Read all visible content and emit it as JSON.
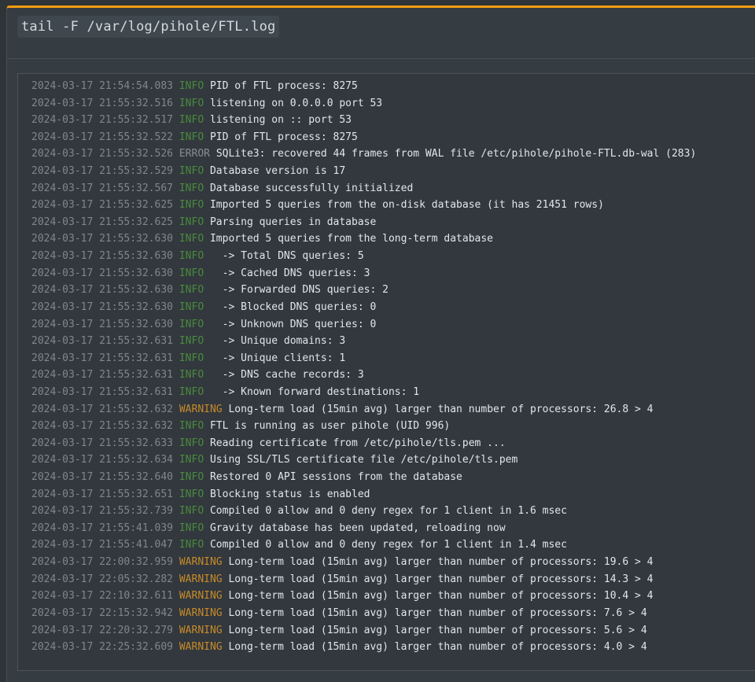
{
  "box": {
    "title": "tail -F /var/log/pihole/FTL.log"
  },
  "log": [
    {
      "time": "2024-03-17 21:54:54.083",
      "level": "INFO",
      "pad": " ",
      "message": "PID of FTL process: 8275"
    },
    {
      "time": "2024-03-17 21:55:32.516",
      "level": "INFO",
      "pad": " ",
      "message": "listening on 0.0.0.0 port 53"
    },
    {
      "time": "2024-03-17 21:55:32.517",
      "level": "INFO",
      "pad": " ",
      "message": "listening on :: port 53"
    },
    {
      "time": "2024-03-17 21:55:32.522",
      "level": "INFO",
      "pad": " ",
      "message": "PID of FTL process: 8275"
    },
    {
      "time": "2024-03-17 21:55:32.526",
      "level": "ERROR",
      "pad": " ",
      "message": "SQLite3: recovered 44 frames from WAL file /etc/pihole/pihole-FTL.db-wal (283)"
    },
    {
      "time": "2024-03-17 21:55:32.529",
      "level": "INFO",
      "pad": " ",
      "message": "Database version is 17"
    },
    {
      "time": "2024-03-17 21:55:32.567",
      "level": "INFO",
      "pad": " ",
      "message": "Database successfully initialized"
    },
    {
      "time": "2024-03-17 21:55:32.625",
      "level": "INFO",
      "pad": " ",
      "message": "Imported 5 queries from the on-disk database (it has 21451 rows)"
    },
    {
      "time": "2024-03-17 21:55:32.625",
      "level": "INFO",
      "pad": " ",
      "message": "Parsing queries in database"
    },
    {
      "time": "2024-03-17 21:55:32.630",
      "level": "INFO",
      "pad": " ",
      "message": "Imported 5 queries from the long-term database"
    },
    {
      "time": "2024-03-17 21:55:32.630",
      "level": "INFO",
      "pad": "  ",
      "message": " -> Total DNS queries: 5"
    },
    {
      "time": "2024-03-17 21:55:32.630",
      "level": "INFO",
      "pad": "  ",
      "message": " -> Cached DNS queries: 3"
    },
    {
      "time": "2024-03-17 21:55:32.630",
      "level": "INFO",
      "pad": "  ",
      "message": " -> Forwarded DNS queries: 2"
    },
    {
      "time": "2024-03-17 21:55:32.630",
      "level": "INFO",
      "pad": "  ",
      "message": " -> Blocked DNS queries: 0"
    },
    {
      "time": "2024-03-17 21:55:32.630",
      "level": "INFO",
      "pad": "  ",
      "message": " -> Unknown DNS queries: 0"
    },
    {
      "time": "2024-03-17 21:55:32.631",
      "level": "INFO",
      "pad": "  ",
      "message": " -> Unique domains: 3"
    },
    {
      "time": "2024-03-17 21:55:32.631",
      "level": "INFO",
      "pad": "  ",
      "message": " -> Unique clients: 1"
    },
    {
      "time": "2024-03-17 21:55:32.631",
      "level": "INFO",
      "pad": "  ",
      "message": " -> DNS cache records: 3"
    },
    {
      "time": "2024-03-17 21:55:32.631",
      "level": "INFO",
      "pad": "  ",
      "message": " -> Known forward destinations: 1"
    },
    {
      "time": "2024-03-17 21:55:32.632",
      "level": "WARNING",
      "pad": " ",
      "message": "Long-term load (15min avg) larger than number of processors: 26.8 > 4"
    },
    {
      "time": "2024-03-17 21:55:32.632",
      "level": "INFO",
      "pad": " ",
      "message": "FTL is running as user pihole (UID 996)"
    },
    {
      "time": "2024-03-17 21:55:32.633",
      "level": "INFO",
      "pad": " ",
      "message": "Reading certificate from /etc/pihole/tls.pem ..."
    },
    {
      "time": "2024-03-17 21:55:32.634",
      "level": "INFO",
      "pad": " ",
      "message": "Using SSL/TLS certificate file /etc/pihole/tls.pem"
    },
    {
      "time": "2024-03-17 21:55:32.640",
      "level": "INFO",
      "pad": " ",
      "message": "Restored 0 API sessions from the database"
    },
    {
      "time": "2024-03-17 21:55:32.651",
      "level": "INFO",
      "pad": " ",
      "message": "Blocking status is enabled"
    },
    {
      "time": "2024-03-17 21:55:32.739",
      "level": "INFO",
      "pad": " ",
      "message": "Compiled 0 allow and 0 deny regex for 1 client in 1.6 msec"
    },
    {
      "time": "2024-03-17 21:55:41.039",
      "level": "INFO",
      "pad": " ",
      "message": "Gravity database has been updated, reloading now"
    },
    {
      "time": "2024-03-17 21:55:41.047",
      "level": "INFO",
      "pad": " ",
      "message": "Compiled 0 allow and 0 deny regex for 1 client in 1.4 msec"
    },
    {
      "time": "2024-03-17 22:00:32.959",
      "level": "WARNING",
      "pad": " ",
      "message": "Long-term load (15min avg) larger than number of processors: 19.6 > 4"
    },
    {
      "time": "2024-03-17 22:05:32.282",
      "level": "WARNING",
      "pad": " ",
      "message": "Long-term load (15min avg) larger than number of processors: 14.3 > 4"
    },
    {
      "time": "2024-03-17 22:10:32.611",
      "level": "WARNING",
      "pad": " ",
      "message": "Long-term load (15min avg) larger than number of processors: 10.4 > 4"
    },
    {
      "time": "2024-03-17 22:15:32.942",
      "level": "WARNING",
      "pad": " ",
      "message": "Long-term load (15min avg) larger than number of processors: 7.6 > 4"
    },
    {
      "time": "2024-03-17 22:20:32.279",
      "level": "WARNING",
      "pad": " ",
      "message": "Long-term load (15min avg) larger than number of processors: 5.6 > 4"
    },
    {
      "time": "2024-03-17 22:25:32.609",
      "level": "WARNING",
      "pad": " ",
      "message": "Long-term load (15min avg) larger than number of processors: 4.0 > 4"
    }
  ]
}
